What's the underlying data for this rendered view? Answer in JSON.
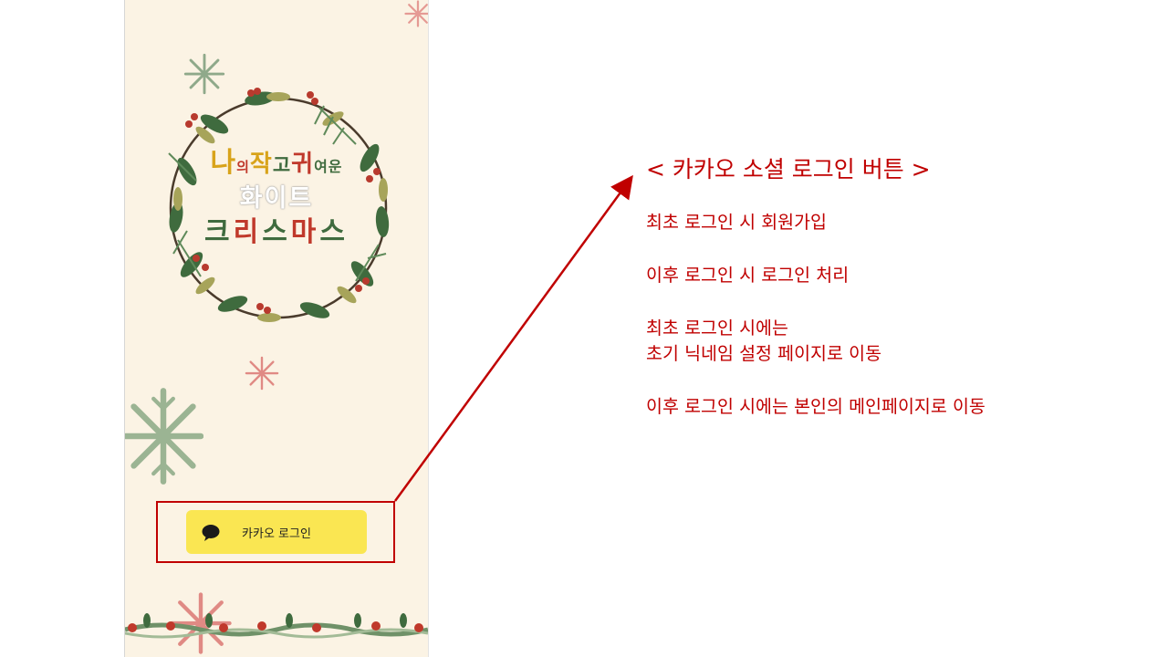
{
  "app": {
    "title_line1": [
      "나",
      "의",
      "작",
      "고",
      "귀",
      "여",
      "운"
    ],
    "title_line2": "화이트",
    "title_line3": [
      "크",
      "리",
      "스",
      "마",
      "스"
    ],
    "login_button_label": "카카오 로그인"
  },
  "annotation": {
    "heading": "< 카카오 소셜 로그인 버튼 >",
    "lines": [
      "최초 로그인 시 회원가입",
      "이후 로그인 시 로그인 처리",
      "최초 로그인 시에는",
      "초기 닉네임 설정 페이지로 이동",
      "이후 로그인 시에는 본인의 메인페이지로 이동"
    ]
  },
  "colors": {
    "annotation_red": "#c00000",
    "kakao_yellow": "#fae652",
    "phone_bg": "#fbf3e4",
    "wreath_green": "#3f6b3e",
    "berry_red": "#c0392b"
  },
  "icons": [
    "speech-bubble-icon",
    "snowflake-icon",
    "wreath-graphic",
    "garland-graphic"
  ]
}
